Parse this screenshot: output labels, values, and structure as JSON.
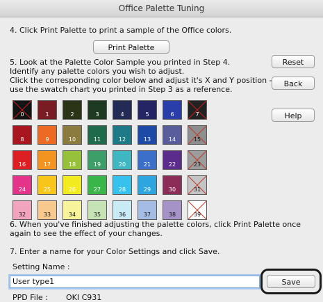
{
  "window": {
    "title": "Office Palette Tuning"
  },
  "steps": {
    "step4": "4. Click Print Palette to print a sample of the Office colors.",
    "step5_lines": [
      "5. Look at the Palette Color Sample you printed in Step 4.",
      "Identify any palette colors you wish to adjust.",
      "Click the corresponding color below and adjust it's X and Y position -",
      "use the swatch chart you printed in Step 3 as a reference."
    ],
    "step6_lines": [
      "6. When you've finished adjusting the palette colors, click Print Palette once",
      "again to see the effect of your changes."
    ],
    "step7": "7. Enter a name for your Color Settings and click Save."
  },
  "buttons": {
    "print_palette": "Print Palette",
    "reset": "Reset",
    "back": "Back",
    "help": "Help",
    "save": "Save"
  },
  "setting_name": {
    "label": "Setting Name :",
    "value": "User type1"
  },
  "ppd_file": {
    "label": "PPD File :",
    "value": "OKI C931"
  },
  "palette": [
    {
      "n": "0",
      "color": "#131313",
      "crossed": true
    },
    {
      "n": "1",
      "color": "#7a1c24",
      "crossed": false
    },
    {
      "n": "2",
      "color": "#2c3418",
      "crossed": false
    },
    {
      "n": "3",
      "color": "#1f3a22",
      "crossed": false
    },
    {
      "n": "4",
      "color": "#232a55",
      "crossed": false
    },
    {
      "n": "5",
      "color": "#252566",
      "crossed": false
    },
    {
      "n": "6",
      "color": "#2a3eaa",
      "crossed": false
    },
    {
      "n": "7",
      "color": "#222222",
      "crossed": true
    },
    {
      "n": "8",
      "color": "#a8171f",
      "crossed": false
    },
    {
      "n": "9",
      "color": "#ec6a24",
      "crossed": false
    },
    {
      "n": "10",
      "color": "#8c7b3e",
      "crossed": false
    },
    {
      "n": "11",
      "color": "#1f6a4a",
      "crossed": false
    },
    {
      "n": "12",
      "color": "#1d7a86",
      "crossed": false
    },
    {
      "n": "13",
      "color": "#1c4aa6",
      "crossed": false
    },
    {
      "n": "14",
      "color": "#5a5d9c",
      "crossed": false
    },
    {
      "n": "15",
      "color": "#8e8e8e",
      "crossed": true
    },
    {
      "n": "16",
      "color": "#dd1f24",
      "crossed": false
    },
    {
      "n": "17",
      "color": "#f39420",
      "crossed": false
    },
    {
      "n": "18",
      "color": "#98c13b",
      "crossed": false
    },
    {
      "n": "19",
      "color": "#3e9e6a",
      "crossed": false
    },
    {
      "n": "20",
      "color": "#3fb6c2",
      "crossed": false
    },
    {
      "n": "21",
      "color": "#3b6fc9",
      "crossed": false
    },
    {
      "n": "22",
      "color": "#5b2c8c",
      "crossed": false
    },
    {
      "n": "23",
      "color": "#9c9c9c",
      "crossed": true
    },
    {
      "n": "24",
      "color": "#e3348a",
      "crossed": false
    },
    {
      "n": "25",
      "color": "#f8c51b",
      "crossed": false
    },
    {
      "n": "26",
      "color": "#f2eb1f",
      "crossed": false
    },
    {
      "n": "27",
      "color": "#39b54a",
      "crossed": false
    },
    {
      "n": "28",
      "color": "#36c2ec",
      "crossed": false
    },
    {
      "n": "29",
      "color": "#2ca5e0",
      "crossed": false
    },
    {
      "n": "30",
      "color": "#8b2d56",
      "crossed": false
    },
    {
      "n": "31",
      "color": "#c4c4c4",
      "crossed": true
    },
    {
      "n": "32",
      "color": "#f2a3bd",
      "crossed": false
    },
    {
      "n": "33",
      "color": "#f7c98f",
      "crossed": false
    },
    {
      "n": "34",
      "color": "#f7f39a",
      "crossed": false
    },
    {
      "n": "35",
      "color": "#c6e3b5",
      "crossed": false
    },
    {
      "n": "36",
      "color": "#c9ebf6",
      "crossed": false
    },
    {
      "n": "37",
      "color": "#a5bde4",
      "crossed": false
    },
    {
      "n": "38",
      "color": "#a593c7",
      "crossed": false
    },
    {
      "n": "39",
      "color": "#ffffff",
      "crossed": true
    }
  ]
}
